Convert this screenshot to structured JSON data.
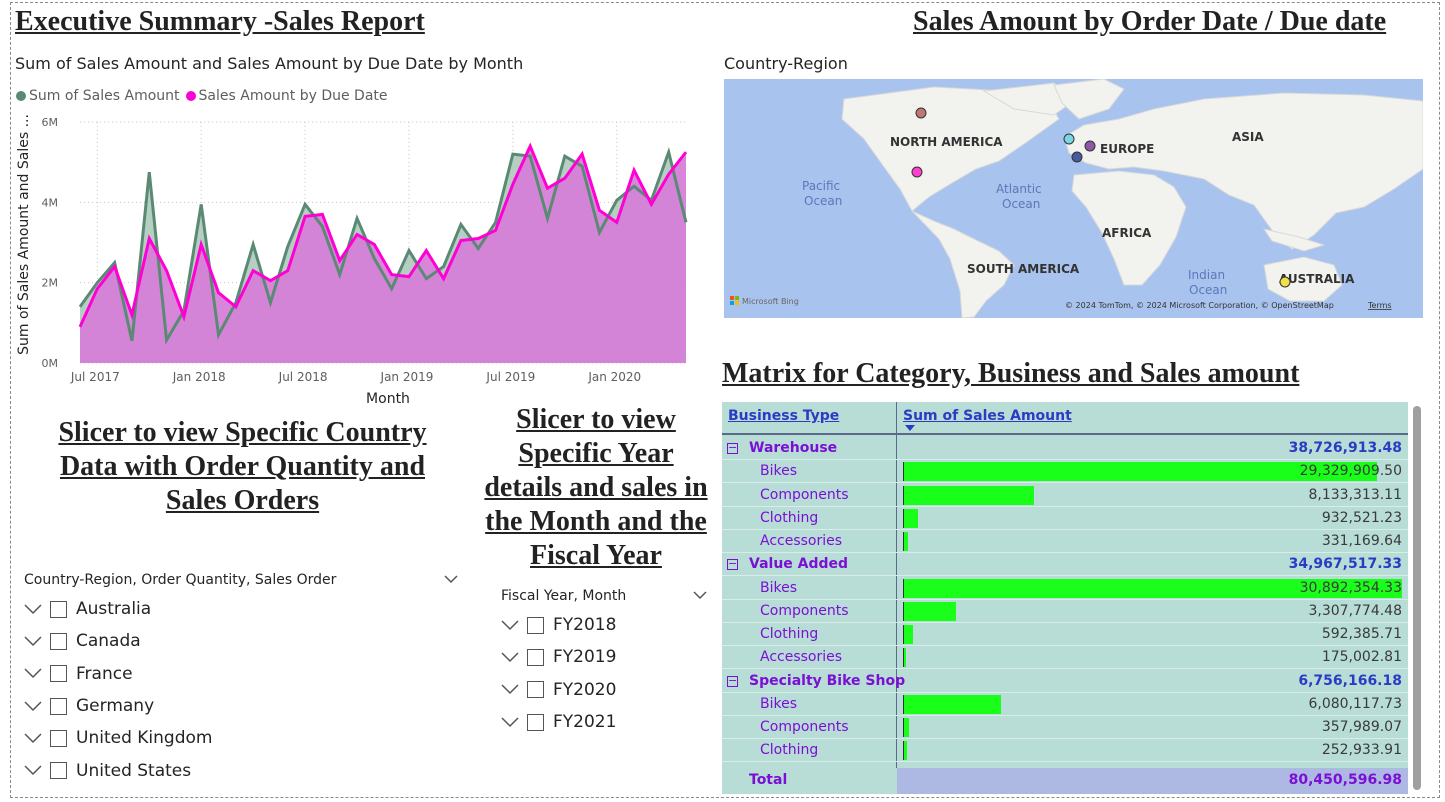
{
  "headings": {
    "exec_summary": "Executive Summary -Sales Report",
    "sales_by_date": "Sales Amount by Order Date / Due date",
    "matrix_title": "Matrix for Category, Business and Sales amount",
    "country_slicer_title": "Slicer to view Specific Country Data with Order Quantity and Sales Orders",
    "year_slicer_title": "Slicer to view Specific Year details and sales in the Month and the Fiscal Year"
  },
  "chart_data": {
    "type": "area",
    "title": "Sum of Sales Amount and Sales Amount by Due Date by Month",
    "xlabel": "Month",
    "ylabel": "Sum of Sales Amount and Sales ...",
    "ylim": [
      0,
      6000000
    ],
    "yticks": [
      "0M",
      "2M",
      "4M",
      "6M"
    ],
    "xticks": [
      "Jul 2017",
      "Jan 2018",
      "Jul 2018",
      "Jan 2019",
      "Jul 2019",
      "Jan 2020"
    ],
    "grid": true,
    "legend_position": "top-left",
    "x": [
      "2017-06",
      "2017-07",
      "2017-08",
      "2017-09",
      "2017-10",
      "2017-11",
      "2017-12",
      "2018-01",
      "2018-02",
      "2018-03",
      "2018-04",
      "2018-05",
      "2018-06",
      "2018-07",
      "2018-08",
      "2018-09",
      "2018-10",
      "2018-11",
      "2018-12",
      "2019-01",
      "2019-02",
      "2019-03",
      "2019-04",
      "2019-05",
      "2019-06",
      "2019-07",
      "2019-08",
      "2019-09",
      "2019-10",
      "2019-11",
      "2019-12",
      "2020-01",
      "2020-02",
      "2020-03",
      "2020-04",
      "2020-05",
      "2020-06"
    ],
    "series": [
      {
        "name": "Sum of Sales Amount",
        "color": "#5a8a74",
        "values": [
          1400000,
          2000000,
          2500000,
          550000,
          4750000,
          570000,
          1300000,
          3950000,
          700000,
          1500000,
          2950000,
          1500000,
          2900000,
          3950000,
          3400000,
          2200000,
          3600000,
          2600000,
          1850000,
          2800000,
          2100000,
          2400000,
          3450000,
          2850000,
          3500000,
          5200000,
          5150000,
          3600000,
          5150000,
          4900000,
          3250000,
          4050000,
          4400000,
          4050000,
          5250000,
          3500000
        ]
      },
      {
        "name": "Sales Amount by Due Date",
        "color": "#ff00d4",
        "values": [
          900000,
          1850000,
          2400000,
          1200000,
          3100000,
          2300000,
          1150000,
          2950000,
          1750000,
          1400000,
          2300000,
          2050000,
          2300000,
          3650000,
          3700000,
          2550000,
          3200000,
          2950000,
          2200000,
          2150000,
          2800000,
          2100000,
          3050000,
          3100000,
          3300000,
          4450000,
          5400000,
          4350000,
          4600000,
          5200000,
          3800000,
          3500000,
          4800000,
          3950000,
          4700000,
          5250000
        ]
      }
    ]
  },
  "map": {
    "title": "Country-Region",
    "labels": {
      "north_america": "NORTH AMERICA",
      "south_america": "SOUTH AMERICA",
      "europe": "EUROPE",
      "asia": "ASIA",
      "africa": "AFRICA",
      "australia": "AUSTRALIA",
      "pacific1": "Pacific",
      "pacific2": "Ocean",
      "atlantic1": "Atlantic",
      "atlantic2": "Ocean",
      "indian1": "Indian",
      "indian2": "Ocean"
    },
    "attribution": "© 2024 TomTom, © 2024 Microsoft Corporation, © OpenStreetMap",
    "terms": "Terms",
    "logo": "Microsoft Bing",
    "points": [
      {
        "color": "#c0786e"
      },
      {
        "color": "#ff3fd0"
      },
      {
        "color": "#7ad6e4"
      },
      {
        "color": "#8a5aa8"
      },
      {
        "color": "#4a5aa0"
      },
      {
        "color": "#f0e04a"
      }
    ]
  },
  "country_slicer": {
    "header": "Country-Region, Order Quantity, Sales Order",
    "items": [
      "Australia",
      "Canada",
      "France",
      "Germany",
      "United Kingdom",
      "United States"
    ]
  },
  "year_slicer": {
    "header": "Fiscal Year, Month",
    "items": [
      "FY2018",
      "FY2019",
      "FY2020",
      "FY2021"
    ]
  },
  "matrix": {
    "col1": "Business Type",
    "col2": "Sum of Sales Amount",
    "max_value": 30892354.33,
    "groups": [
      {
        "label": "Warehouse",
        "total": "38,726,913.48",
        "rows": [
          {
            "label": "Bikes",
            "value": "29,329,909.50",
            "num": 29329909.5
          },
          {
            "label": "Components",
            "value": "8,133,313.11",
            "num": 8133313.11
          },
          {
            "label": "Clothing",
            "value": "932,521.23",
            "num": 932521.23
          },
          {
            "label": "Accessories",
            "value": "331,169.64",
            "num": 331169.64
          }
        ]
      },
      {
        "label": "Value Added",
        "total": "34,967,517.33",
        "rows": [
          {
            "label": "Bikes",
            "value": "30,892,354.33",
            "num": 30892354.33
          },
          {
            "label": "Components",
            "value": "3,307,774.48",
            "num": 3307774.48
          },
          {
            "label": "Clothing",
            "value": "592,385.71",
            "num": 592385.71
          },
          {
            "label": "Accessories",
            "value": "175,002.81",
            "num": 175002.81
          }
        ]
      },
      {
        "label": "Specialty Bike Shop",
        "total": "6,756,166.18",
        "rows": [
          {
            "label": "Bikes",
            "value": "6,080,117.73",
            "num": 6080117.73
          },
          {
            "label": "Components",
            "value": "357,989.07",
            "num": 357989.07
          },
          {
            "label": "Clothing",
            "value": "252,933.91",
            "num": 252933.91
          }
        ]
      }
    ],
    "total_label": "Total",
    "total_value": "80,450,596.98"
  }
}
